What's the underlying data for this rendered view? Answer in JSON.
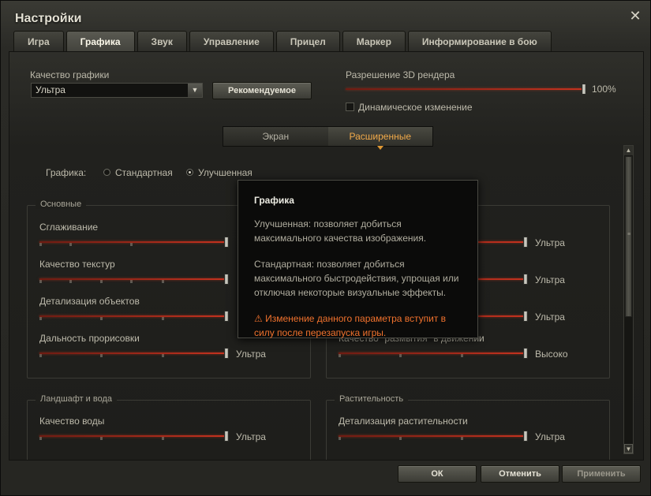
{
  "window": {
    "title": "Настройки",
    "close_glyph": "✕"
  },
  "tabs": [
    {
      "label": "Игра",
      "active": false
    },
    {
      "label": "Графика",
      "active": true
    },
    {
      "label": "Звук",
      "active": false
    },
    {
      "label": "Управление",
      "active": false
    },
    {
      "label": "Прицел",
      "active": false
    },
    {
      "label": "Маркер",
      "active": false
    },
    {
      "label": "Информирование в бою",
      "active": false
    }
  ],
  "quality": {
    "label": "Качество графики",
    "value": "Ультра",
    "recommended_button": "Рекомендуемое"
  },
  "render": {
    "label": "Разрешение 3D рендера",
    "value_text": "100%",
    "value_fraction": 1.0,
    "dynamic_label": "Динамическое изменение",
    "dynamic_checked": false
  },
  "subtabs": [
    {
      "label": "Экран",
      "active": false
    },
    {
      "label": "Расширенные",
      "active": true
    }
  ],
  "graphics_mode": {
    "label": "Графика:",
    "options": [
      {
        "label": "Стандартная",
        "checked": false
      },
      {
        "label": "Улучшенная",
        "checked": true
      }
    ]
  },
  "groups": {
    "basic": {
      "title": "Основные",
      "settings": [
        {
          "label": "Сглаживание",
          "level": 1.0,
          "value_text": ""
        },
        {
          "label": "Качество текстур",
          "level": 1.0,
          "value_text": ""
        },
        {
          "label": "Детализация объектов",
          "level": 1.0,
          "value_text": ""
        },
        {
          "label": "Дальность прорисовки",
          "level": 1.0,
          "value_text": "Ультра"
        }
      ]
    },
    "right_top": {
      "settings": [
        {
          "label": "",
          "level": 1.0,
          "value_text": "Ультра"
        },
        {
          "label": "",
          "level": 1.0,
          "value_text": "Ультра"
        },
        {
          "label": "",
          "level": 1.0,
          "value_text": "Ультра"
        },
        {
          "label": "Качество \"размытия\" в движении",
          "level": 1.0,
          "value_text": "Высоко"
        }
      ]
    },
    "landscape": {
      "title": "Ландшафт и вода",
      "settings": [
        {
          "label": "Качество воды",
          "level": 1.0,
          "value_text": "Ультра"
        }
      ]
    },
    "vegetation": {
      "title": "Растительность",
      "settings": [
        {
          "label": "Детализация растительности",
          "level": 1.0,
          "value_text": "Ультра"
        }
      ]
    }
  },
  "tooltip": {
    "title": "Графика",
    "text1": "Улучшенная: позволяет добиться максимального качества изображения.",
    "text2": "Стандартная: позволяет добиться максимального быстродействия, упрощая или отключая некоторые визуальные эффекты.",
    "warning": "Изменение данного параметра вступит в силу после перезапуска игры.",
    "warning_icon": "⚠"
  },
  "scrollbar": {
    "up_glyph": "▲",
    "down_glyph": "▼",
    "grip": "≡"
  },
  "footer": {
    "ok": "ОК",
    "cancel": "Отменить",
    "apply": "Применить"
  },
  "colors": {
    "accent_orange": "#f3ab4a",
    "slider_red": "#c5321f",
    "warning": "#f1722d"
  }
}
